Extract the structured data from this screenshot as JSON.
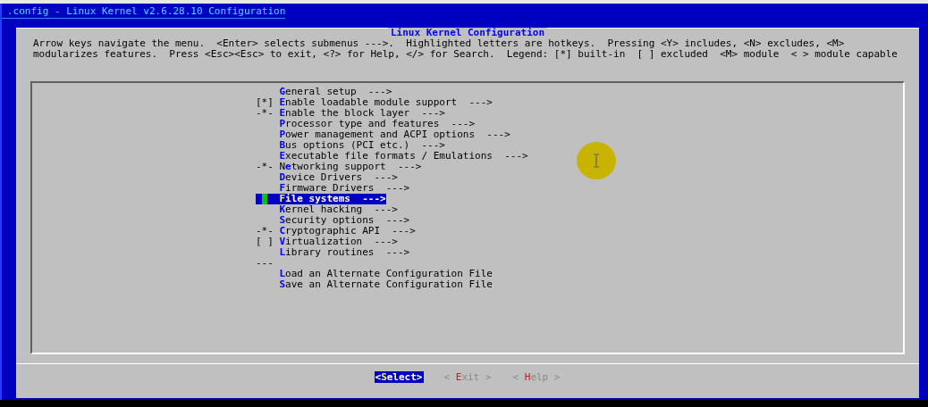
{
  "title_bar": {
    "title": ".config - Linux Kernel v2.6.28.10 Configuration"
  },
  "dialog": {
    "title": "Linux Kernel Configuration",
    "help_lines": [
      "Arrow keys navigate the menu.  <Enter> selects submenus --->.  Highlighted letters are hotkeys.  Pressing <Y> includes, <N> excludes, <M>",
      "modularizes features.  Press <Esc><Esc> to exit, <?> for Help, </> for Search.  Legend: [*] built-in  [ ] excluded  <M> module  < > module capable"
    ]
  },
  "menu": [
    {
      "kind": "item",
      "hotkey": "G",
      "after": "eneral setup  --->",
      "selected": false
    },
    {
      "kind": "item",
      "prefix": "[*]",
      "hotkey": "E",
      "after": "nable loadable module support  --->",
      "selected": false
    },
    {
      "kind": "item",
      "prefix": "-*-",
      "hotkey": "E",
      "after": "nable the block layer  --->",
      "selected": false
    },
    {
      "kind": "item",
      "hotkey": "P",
      "after": "rocessor type and features  --->",
      "selected": false
    },
    {
      "kind": "item",
      "hotkey": "P",
      "after": "ower management and ACPI options  --->",
      "selected": false
    },
    {
      "kind": "item",
      "hotkey": "B",
      "after": "us options (PCI etc.)  --->",
      "selected": false
    },
    {
      "kind": "item",
      "hotkey": "E",
      "after": "xecutable file formats / Emulations  --->",
      "selected": false
    },
    {
      "kind": "item",
      "prefix": "-*-",
      "before": "N",
      "hotkey": "e",
      "after": "tworking support  --->",
      "selected": false
    },
    {
      "kind": "item",
      "hotkey": "D",
      "after": "evice Drivers  --->",
      "selected": false
    },
    {
      "kind": "item",
      "hotkey": "F",
      "after": "irmware Drivers  --->",
      "selected": false
    },
    {
      "kind": "item",
      "hotkey": "F",
      "after": "ile systems  --->",
      "selected": true
    },
    {
      "kind": "item",
      "hotkey": "K",
      "after": "ernel hacking  --->",
      "selected": false
    },
    {
      "kind": "item",
      "hotkey": "S",
      "after": "ecurity options  --->",
      "selected": false
    },
    {
      "kind": "item",
      "prefix": "-*-",
      "hotkey": "C",
      "after": "ryptographic API  --->",
      "selected": false
    },
    {
      "kind": "item",
      "prefix": "[ ]",
      "hotkey": "V",
      "after": "irtualization  --->",
      "selected": false
    },
    {
      "kind": "item",
      "hotkey": "L",
      "after": "ibrary routines  --->",
      "selected": false
    },
    {
      "kind": "separator",
      "text": "---"
    },
    {
      "kind": "item",
      "hotkey": "L",
      "after": "oad an Alternate Configuration File",
      "selected": false
    },
    {
      "kind": "item",
      "hotkey": "S",
      "after": "ave an Alternate Configuration File",
      "selected": false
    }
  ],
  "buttons": [
    {
      "before": "<",
      "hotkey": "S",
      "after": "elect>",
      "selected": true
    },
    {
      "before": "< ",
      "hotkey": "E",
      "after": "xit >",
      "selected": false
    },
    {
      "before": "< ",
      "hotkey": "H",
      "after": "elp >",
      "selected": false
    }
  ]
}
